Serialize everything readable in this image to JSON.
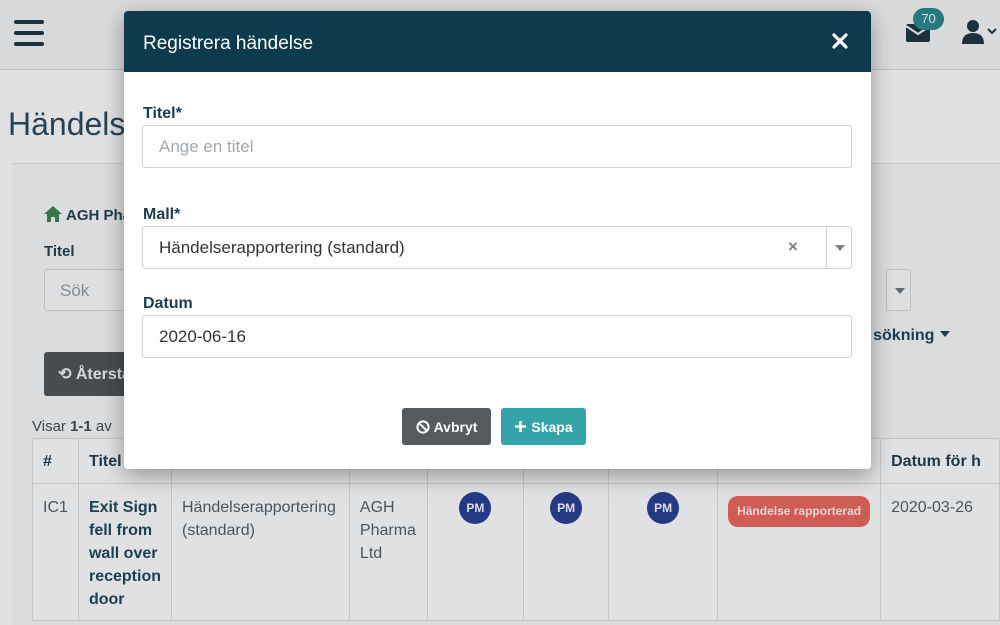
{
  "header": {
    "notification_count": "70"
  },
  "page": {
    "title": "Händelser",
    "org_name": "AGH Pharma Ltd",
    "filter_label": "Titel",
    "search_placeholder": "Sök",
    "advanced_search": "ad sökning",
    "reset_button": "Återställ",
    "showing_prefix": "Visar ",
    "showing_range": "1-1",
    "showing_suffix": " av"
  },
  "table": {
    "headers": [
      "#",
      "Titel",
      "",
      "",
      "",
      "",
      "",
      "",
      "Datum för h"
    ],
    "row": {
      "id": "IC1",
      "title": "Exit Sign fell from wall over reception door",
      "template": "Händelserapportering (standard)",
      "org": "AGH Pharma Ltd",
      "pm1": "PM",
      "pm2": "PM",
      "pm3": "PM",
      "status": "Händelse rapporterad",
      "date": "2020-03-26"
    }
  },
  "modal": {
    "title": "Registrera händelse",
    "title_label": "Titel*",
    "title_placeholder": "Ange en titel",
    "title_value": "",
    "template_label": "Mall*",
    "template_value": "Händelserapportering (standard)",
    "template_clear": "×",
    "date_label": "Datum",
    "date_value": "2020-06-16",
    "cancel_label": "Avbryt",
    "create_label": "Skapa"
  },
  "colors": {
    "modal_header": "#0e3a4e",
    "cancel_button": "#555a5e",
    "create_button": "#34a4a8",
    "status_badge": "#d9625a",
    "pm_avatar": "#283e8c"
  },
  "icons": [
    "hamburger-menu-icon",
    "mail-icon",
    "user-icon",
    "chevron-down-icon",
    "home-icon",
    "undo-icon",
    "close-icon",
    "ban-icon",
    "plus-icon"
  ]
}
